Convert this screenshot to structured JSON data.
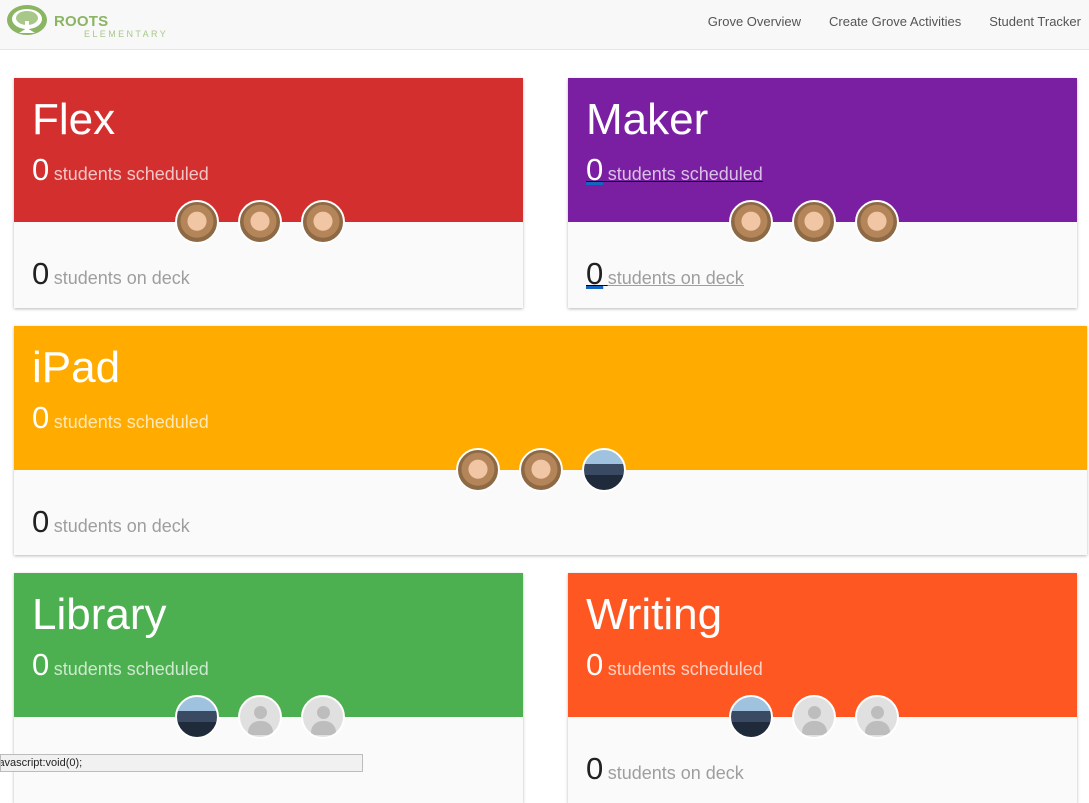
{
  "brand": {
    "name": "ROOTS",
    "tagline": "ELEMENTARY",
    "color": "#8ab562"
  },
  "nav": {
    "links": [
      {
        "label": "Grove Overview"
      },
      {
        "label": "Create Grove Activities"
      },
      {
        "label": "Student Tracker"
      }
    ]
  },
  "groves": [
    {
      "title": "Flex",
      "color": "#d32f2f",
      "scheduled": "0",
      "scheduled_label": "students scheduled",
      "on_deck": "0",
      "on_deck_label": "students on deck",
      "avatars": [
        "face",
        "face",
        "face"
      ]
    },
    {
      "title": "Maker",
      "color": "#7b1fa2",
      "scheduled": "0",
      "scheduled_label": "students scheduled",
      "on_deck": "0",
      "on_deck_label": "students on deck",
      "avatars": [
        "face",
        "face",
        "face"
      ]
    },
    {
      "title": "iPad",
      "color": "#ffab00",
      "scheduled": "0",
      "scheduled_label": "students scheduled",
      "on_deck": "0",
      "on_deck_label": "students on deck",
      "avatars": [
        "face",
        "face",
        "photo"
      ]
    },
    {
      "title": "Library",
      "color": "#4caf50",
      "scheduled": "0",
      "scheduled_label": "students scheduled",
      "avatars": [
        "photo",
        "blank",
        "blank"
      ]
    },
    {
      "title": "Writing",
      "color": "#ff5722",
      "scheduled": "0",
      "scheduled_label": "students scheduled",
      "on_deck": "0",
      "on_deck_label": "students on deck",
      "avatars": [
        "photo",
        "blank",
        "blank"
      ]
    }
  ],
  "status_bar": {
    "url": "javascript:void(0);"
  }
}
